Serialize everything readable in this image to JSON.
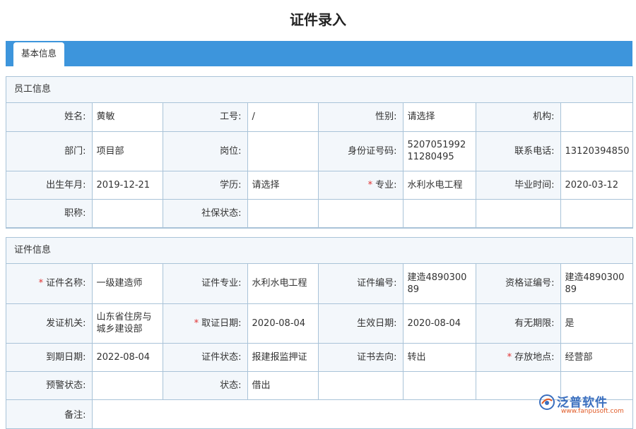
{
  "page_title": "证件录入",
  "tabs": [
    {
      "label": "基本信息",
      "active": true
    }
  ],
  "employee_section": {
    "title": "员工信息",
    "fields": {
      "name": {
        "label": "姓名:",
        "value": "黄敏"
      },
      "employee_no": {
        "label": "工号:",
        "value": "/"
      },
      "gender": {
        "label": "性别:",
        "value": "请选择"
      },
      "org": {
        "label": "机构:",
        "value": ""
      },
      "dept": {
        "label": "部门:",
        "value": "项目部"
      },
      "position": {
        "label": "岗位:",
        "value": ""
      },
      "id_no": {
        "label": "身份证号码:",
        "value": "520705199211280495"
      },
      "phone": {
        "label": "联系电话:",
        "value": "13120394850"
      },
      "birth": {
        "label": "出生年月:",
        "value": "2019-12-21"
      },
      "education": {
        "label": "学历:",
        "value": "请选择"
      },
      "major": {
        "label": "专业:",
        "value": "水利水电工程",
        "required": true
      },
      "grad_date": {
        "label": "毕业时间:",
        "value": "2020-03-12"
      },
      "title": {
        "label": "职称:",
        "value": ""
      },
      "social_status": {
        "label": "社保状态:",
        "value": ""
      }
    }
  },
  "cert_section": {
    "title": "证件信息",
    "fields": {
      "cert_name": {
        "label": "证件名称:",
        "value": "一级建造师",
        "required": true
      },
      "cert_major": {
        "label": "证件专业:",
        "value": "水利水电工程"
      },
      "cert_no": {
        "label": "证件编号:",
        "value": "建造489030089"
      },
      "qual_no": {
        "label": "资格证编号:",
        "value": "建造489030089"
      },
      "issuer": {
        "label": "发证机关:",
        "value": "山东省住房与城乡建设部"
      },
      "issue_date": {
        "label": "取证日期:",
        "value": "2020-08-04",
        "required": true
      },
      "effective_date": {
        "label": "生效日期:",
        "value": "2020-08-04"
      },
      "has_expiry": {
        "label": "有无期限:",
        "value": "是"
      },
      "expiry_date": {
        "label": "到期日期:",
        "value": "2022-08-04"
      },
      "cert_status": {
        "label": "证件状态:",
        "value": "报建报监押证"
      },
      "destination": {
        "label": "证书去向:",
        "value": "转出"
      },
      "storage": {
        "label": "存放地点:",
        "value": "经营部",
        "required": true
      },
      "warning_status": {
        "label": "预警状态:",
        "value": ""
      },
      "status": {
        "label": "状态:",
        "value": "借出"
      },
      "remark": {
        "label": "备注:",
        "value": ""
      }
    }
  },
  "watermark": {
    "brand": "泛普软件",
    "url": "www.fanpusoft.com",
    "colors": {
      "brand": "#3a6fbf",
      "url": "#e05a26"
    }
  },
  "colors": {
    "tab_bar": "#3d95dc",
    "label_bg": "#f3f7fb",
    "border": "#a9c3d8",
    "required": "#e03030"
  }
}
